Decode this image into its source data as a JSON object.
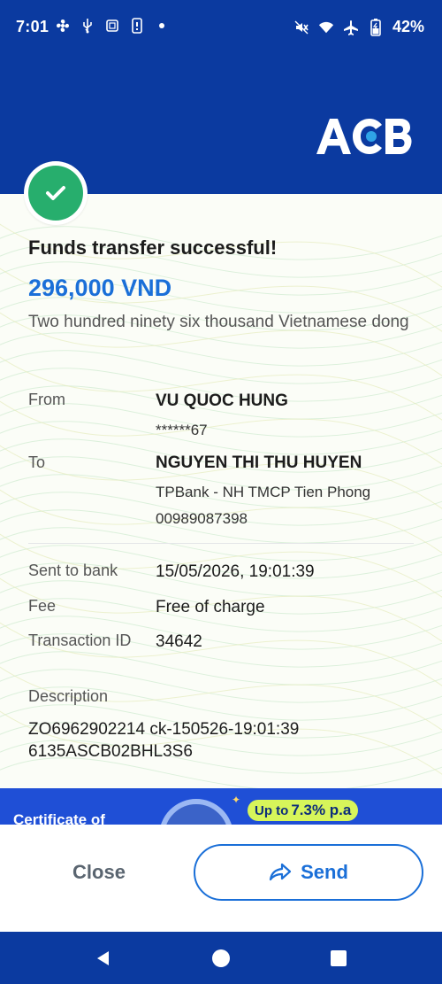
{
  "status_bar": {
    "time": "7:01",
    "battery": "42%",
    "left_icons": [
      "fan-icon",
      "usb-icon",
      "screen-icon",
      "sim-icon",
      "dot-icon"
    ],
    "right_icons": [
      "mute-icon",
      "wifi-icon",
      "airplane-icon",
      "battery-icon"
    ]
  },
  "header": {
    "brand": "ACB"
  },
  "receipt": {
    "title": "Funds transfer successful!",
    "amount": "296,000 VND",
    "amount_words": "Two hundred ninety six thousand Vietnamese dong",
    "from": {
      "label": "From",
      "name": "VU QUOC HUNG",
      "account": "******67"
    },
    "to": {
      "label": "To",
      "name": "NGUYEN THI THU HUYEN",
      "bank": "TPBank - NH TMCP Tien Phong",
      "account": "00989087398"
    },
    "sent_to_bank": {
      "label": "Sent to bank",
      "value": "15/05/2026, 19:01:39"
    },
    "fee": {
      "label": "Fee",
      "value": "Free of charge"
    },
    "transaction_id": {
      "label": "Transaction ID",
      "value": "34642"
    },
    "description": {
      "label": "Description",
      "value": "ZO6962902214 ck-150526-19:01:39 6135ASCB02BHL3S6"
    }
  },
  "banner": {
    "text": "Certificate of",
    "pill_prefix": "Up to",
    "pill_rate": "7.3% p.a"
  },
  "actions": {
    "close": "Close",
    "send": "Send"
  },
  "colors": {
    "brand_blue": "#0b3aa0",
    "accent_blue": "#1a6fd8",
    "success_green": "#27ae6d"
  }
}
